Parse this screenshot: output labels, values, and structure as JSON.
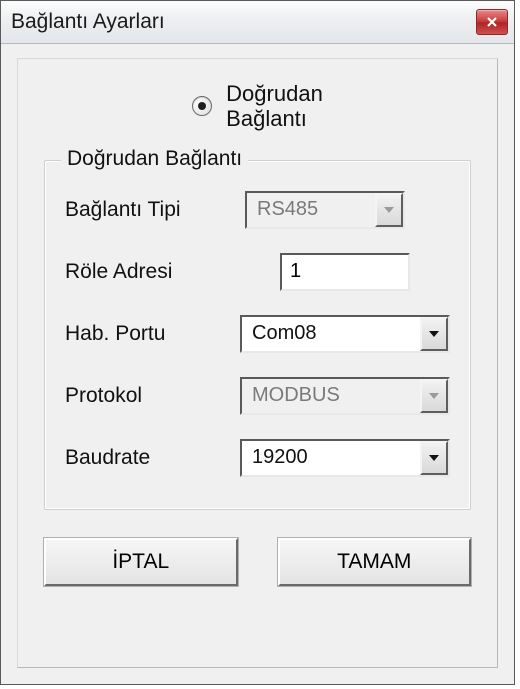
{
  "window": {
    "title": "Bağlantı Ayarları"
  },
  "radio": {
    "label_line1": "Doğrudan",
    "label_line2": "Bağlantı"
  },
  "group": {
    "legend": "Doğrudan Bağlantı"
  },
  "fields": {
    "conn_type": {
      "label": "Bağlantı Tipi",
      "value": "RS485"
    },
    "relay_addr": {
      "label": "Röle Adresi",
      "value": "1"
    },
    "com_port": {
      "label": "Hab. Portu",
      "value": "Com08"
    },
    "protocol": {
      "label": "Protokol",
      "value": "MODBUS"
    },
    "baud": {
      "label": "Baudrate",
      "value": "19200"
    }
  },
  "buttons": {
    "cancel": "İPTAL",
    "ok": "TAMAM"
  }
}
